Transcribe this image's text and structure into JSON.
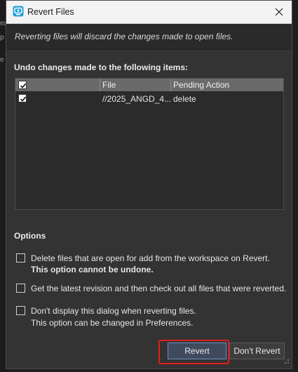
{
  "background": {
    "fragments": [
      "ea",
      "p",
      "e"
    ]
  },
  "dialog": {
    "title": "Revert Files",
    "app_icon": "p4v-icon",
    "close_icon": "close-icon"
  },
  "banner": {
    "message": "Reverting files will discard the changes made to open files."
  },
  "items_section": {
    "label": "Undo changes made to the following items:",
    "columns": [
      "",
      "File",
      "Pending Action"
    ],
    "rows": [
      {
        "checked": true,
        "file": "//2025_ANGD_4...",
        "action": "delete"
      }
    ],
    "select_all_checked": true
  },
  "options": {
    "label": "Options",
    "items": [
      {
        "checked": false,
        "line1": "Delete files that are open for add from the workspace on Revert.",
        "line2": "This option cannot be undone.",
        "line2_bold": true
      },
      {
        "checked": false,
        "line1": "Get the latest revision and then check out all files that were reverted.",
        "line2": ""
      },
      {
        "checked": false,
        "line1": "Don't display this dialog when reverting files.",
        "line2": "This option can be changed in Preferences."
      }
    ]
  },
  "buttons": {
    "revert": "Revert",
    "dont_revert": "Don't Revert"
  },
  "colors": {
    "dialog_bg": "#333333",
    "titlebar_bg": "#f3f3f3",
    "header_bg": "#6a6a6a",
    "highlight": "#e01e1e",
    "accent": "#6d8fc4"
  }
}
